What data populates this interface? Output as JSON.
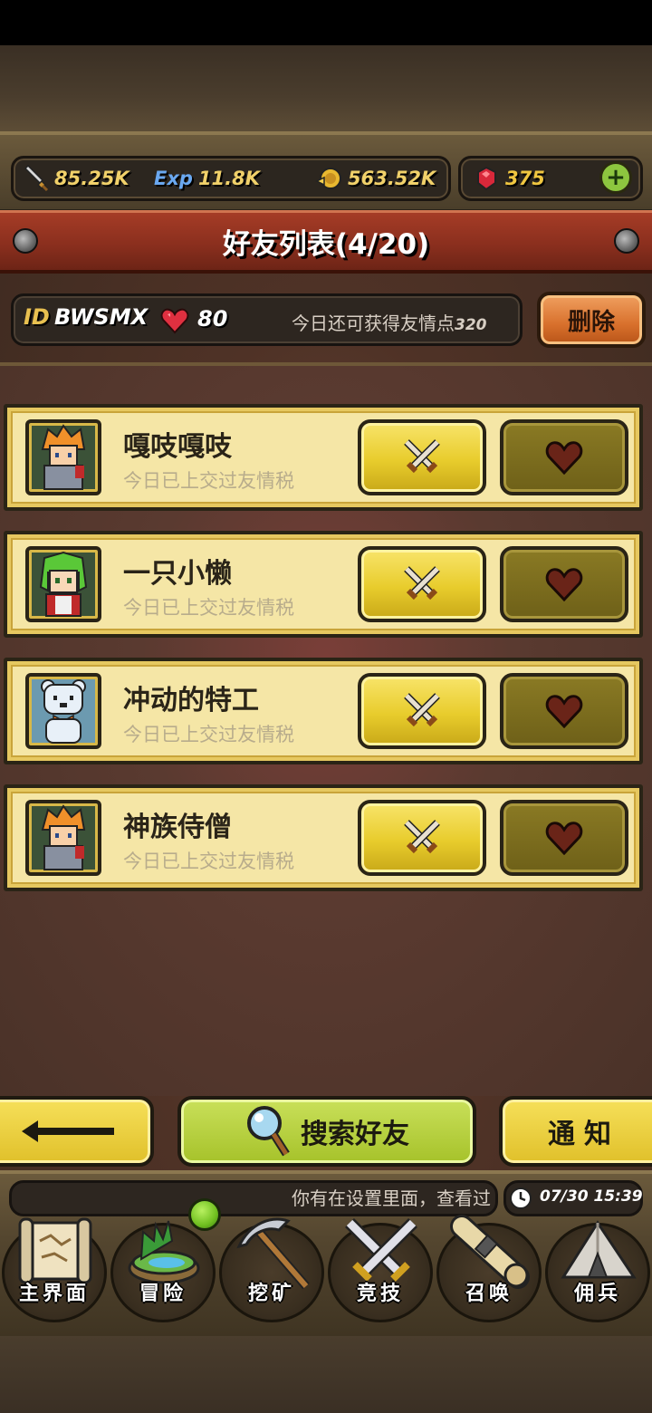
{
  "resources": {
    "attack": "85.25K",
    "exp_label": "Exp",
    "exp": "11.8K",
    "gold": "563.52K",
    "gems": "375"
  },
  "header": {
    "title": "好友列表(4/20)"
  },
  "profile": {
    "id_label": "ID",
    "id_value": "BWSMX",
    "hearts": "80",
    "points_text": "今日还可获得友情点",
    "points_value": "320",
    "delete_label": "删除"
  },
  "friends": [
    {
      "name": "嘎吱嘎吱",
      "status": "今日已上交过友情税",
      "avatar": "orange-hair-knight"
    },
    {
      "name": "一只小懒",
      "status": "今日已上交过友情税",
      "avatar": "green-hair-girl"
    },
    {
      "name": "冲动的特工",
      "status": "今日已上交过友情税",
      "avatar": "white-bear"
    },
    {
      "name": "神族侍僧",
      "status": "今日已上交过友情税",
      "avatar": "orange-hair-knight"
    }
  ],
  "actions": {
    "search_label": "搜索好友",
    "notice_label": "通知"
  },
  "ticker": {
    "text": "你有在设置里面，查看过",
    "datetime": "07/30 15:39"
  },
  "nav": [
    {
      "label": "主界面",
      "icon": "map-scroll-icon"
    },
    {
      "label": "冒险",
      "icon": "island-icon"
    },
    {
      "label": "挖矿",
      "icon": "pickaxe-icon"
    },
    {
      "label": "竞技",
      "icon": "crossed-swords-icon"
    },
    {
      "label": "召唤",
      "icon": "summon-scroll-icon"
    },
    {
      "label": "佣兵",
      "icon": "tent-icon"
    }
  ],
  "colors": {
    "banner": "#8b2f1e",
    "card": "#f5e6a6",
    "fight_button": "#e8cc2c",
    "heart_button": "#6e6018",
    "search_button": "#a6c22a",
    "delete_button": "#d8702c"
  }
}
